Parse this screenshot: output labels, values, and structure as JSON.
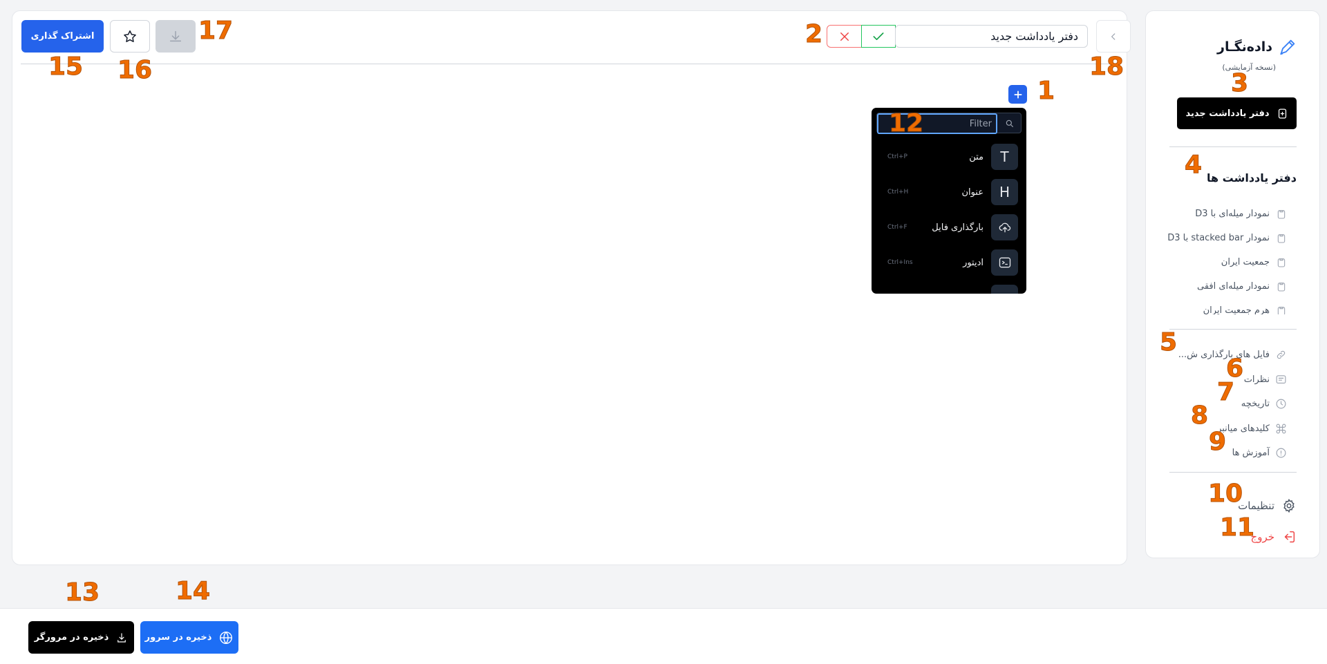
{
  "colors": {
    "primary": "#2563eb",
    "danger": "#ef4444",
    "success": "#22c55e",
    "annotation": "#ef6c00"
  },
  "sidebar": {
    "brand_name": "داده‌نگـار",
    "brand_sub": "(نسخه آزمایشی)",
    "brand_icon": "pen-icon",
    "new_notebook_label": "دفتر یادداشت جدید",
    "notebooks_title": "دفتر یادداشت ها",
    "notebooks": [
      {
        "label": "نمودار میله‌ای با D3"
      },
      {
        "label": "نمودار stacked bar با D3"
      },
      {
        "label": "جمعیت ایران"
      },
      {
        "label": "نمودار میله‌ای افقی"
      },
      {
        "label": "هرم جمعیت ایران"
      }
    ],
    "menu": [
      {
        "label": "فایل های بارگذاری ش...",
        "icon": "link-icon"
      },
      {
        "label": "نظرات",
        "icon": "comment-icon"
      },
      {
        "label": "تاریخچه",
        "icon": "clock-icon"
      },
      {
        "label": "کلیدهای میانبر",
        "icon": "command-icon"
      },
      {
        "label": "آموزش ها",
        "icon": "info-icon"
      }
    ],
    "settings_label": "تنظیمات",
    "logout_label": "خروج"
  },
  "header": {
    "notebook_title": "دفتر یادداشت جدید",
    "share_label": "اشتراک گذاری"
  },
  "block_menu": {
    "filter_placeholder": "Filter",
    "items": [
      {
        "label": "متن",
        "shortcut": "Ctrl+P",
        "icon": "T"
      },
      {
        "label": "عنوان",
        "shortcut": "Ctrl+H",
        "icon": "H"
      },
      {
        "label": "بارگذاری فایل",
        "shortcut": "Ctrl+F",
        "icon": "upload-icon"
      },
      {
        "label": "ادیتور",
        "shortcut": "Ctrl+Ins",
        "icon": "terminal-icon"
      }
    ]
  },
  "bottom": {
    "save_browser_label": "ذخیره در مرورگر",
    "save_server_label": "ذخیره در سرور"
  },
  "annotations": [
    "1",
    "2",
    "3",
    "4",
    "5",
    "6",
    "7",
    "8",
    "9",
    "10",
    "11",
    "12",
    "13",
    "14",
    "15",
    "16",
    "17",
    "18"
  ]
}
